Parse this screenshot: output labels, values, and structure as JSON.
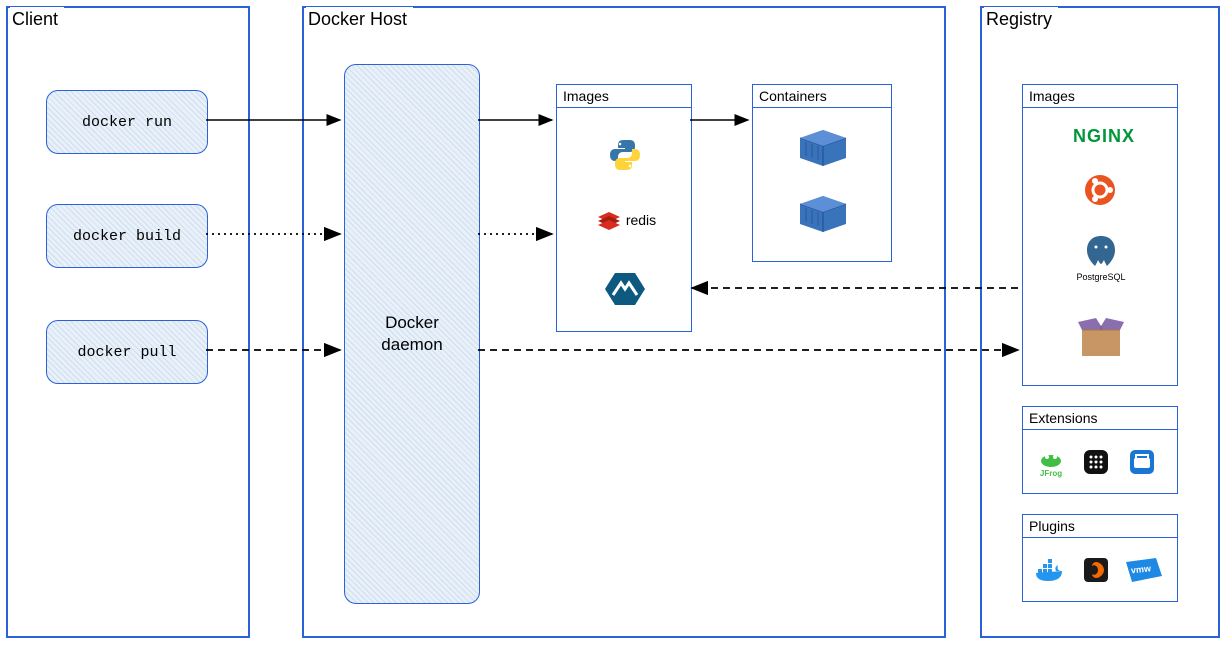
{
  "client": {
    "title": "Client",
    "commands": [
      "docker run",
      "docker build",
      "docker pull"
    ]
  },
  "host": {
    "title": "Docker Host",
    "daemon_label": "Docker daemon",
    "images_title": "Images",
    "containers_title": "Containers",
    "images": [
      {
        "name": "python"
      },
      {
        "name": "redis",
        "label": "redis"
      },
      {
        "name": "alpine"
      }
    ],
    "containers": [
      {
        "name": "container-1"
      },
      {
        "name": "container-2"
      }
    ]
  },
  "registry": {
    "title": "Registry",
    "images_title": "Images",
    "images": [
      {
        "name": "nginx",
        "label": "NGINX"
      },
      {
        "name": "ubuntu"
      },
      {
        "name": "postgresql",
        "label": "PostgreSQL"
      },
      {
        "name": "package"
      }
    ],
    "extensions_title": "Extensions",
    "extensions": [
      {
        "name": "jfrog",
        "label": "JFrog"
      },
      {
        "name": "portainer"
      },
      {
        "name": "disk-usage"
      }
    ],
    "plugins_title": "Plugins",
    "plugins": [
      {
        "name": "docker-plugin"
      },
      {
        "name": "grafana"
      },
      {
        "name": "vmware",
        "label": "vmw"
      }
    ]
  }
}
